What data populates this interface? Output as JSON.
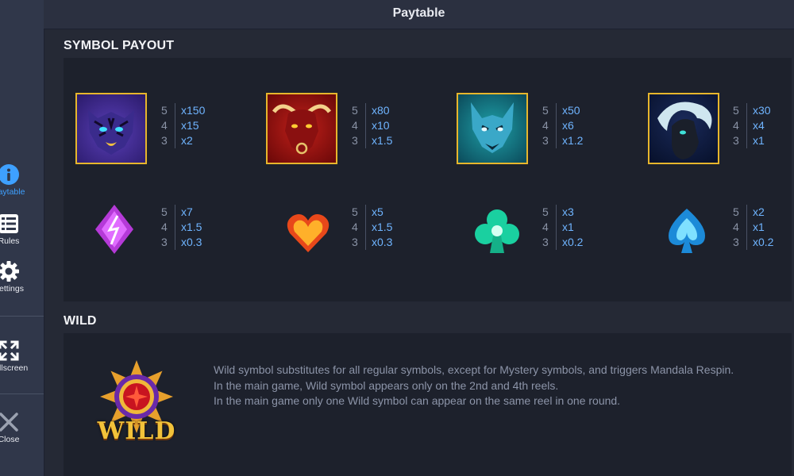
{
  "header": {
    "title": "Paytable"
  },
  "sidebar": {
    "items": [
      {
        "label": "Paytable",
        "icon": "info-icon",
        "active": true
      },
      {
        "label": "Rules",
        "icon": "list-icon"
      },
      {
        "label": "Settings",
        "icon": "gear-icon"
      },
      {
        "label": "Fullscreen",
        "icon": "fullscreen-icon"
      },
      {
        "label": "Close",
        "icon": "close-icon"
      }
    ]
  },
  "symbol_payout": {
    "title": "SYMBOL PAYOUT",
    "symbols": [
      {
        "name": "tiger",
        "payouts": [
          {
            "count": "5",
            "value": "x150"
          },
          {
            "count": "4",
            "value": "x15"
          },
          {
            "count": "3",
            "value": "x2"
          }
        ]
      },
      {
        "name": "bull",
        "payouts": [
          {
            "count": "5",
            "value": "x80"
          },
          {
            "count": "4",
            "value": "x10"
          },
          {
            "count": "3",
            "value": "x1.5"
          }
        ]
      },
      {
        "name": "wolf",
        "payouts": [
          {
            "count": "5",
            "value": "x50"
          },
          {
            "count": "4",
            "value": "x6"
          },
          {
            "count": "3",
            "value": "x1.2"
          }
        ]
      },
      {
        "name": "horse",
        "payouts": [
          {
            "count": "5",
            "value": "x30"
          },
          {
            "count": "4",
            "value": "x4"
          },
          {
            "count": "3",
            "value": "x1"
          }
        ]
      },
      {
        "name": "diamond",
        "payouts": [
          {
            "count": "5",
            "value": "x7"
          },
          {
            "count": "4",
            "value": "x1.5"
          },
          {
            "count": "3",
            "value": "x0.3"
          }
        ]
      },
      {
        "name": "heart",
        "payouts": [
          {
            "count": "5",
            "value": "x5"
          },
          {
            "count": "4",
            "value": "x1.5"
          },
          {
            "count": "3",
            "value": "x0.3"
          }
        ]
      },
      {
        "name": "club",
        "payouts": [
          {
            "count": "5",
            "value": "x3"
          },
          {
            "count": "4",
            "value": "x1"
          },
          {
            "count": "3",
            "value": "x0.2"
          }
        ]
      },
      {
        "name": "spade",
        "payouts": [
          {
            "count": "5",
            "value": "x2"
          },
          {
            "count": "4",
            "value": "x1"
          },
          {
            "count": "3",
            "value": "x0.2"
          }
        ]
      }
    ]
  },
  "wild": {
    "title": "WILD",
    "logo_text": "WILD",
    "lines": [
      "Wild symbol substitutes for all regular symbols, except for Mystery symbols, and triggers Mandala Respin.",
      "In the main game, Wild symbol appears only on the 2nd and 4th reels.",
      "In the main game only one Wild symbol can appear on the same reel in one round."
    ]
  },
  "colors": {
    "accent": "#3ea0ff",
    "payout_value": "#6fb4ff",
    "frame_gold": "#e7b62c"
  }
}
